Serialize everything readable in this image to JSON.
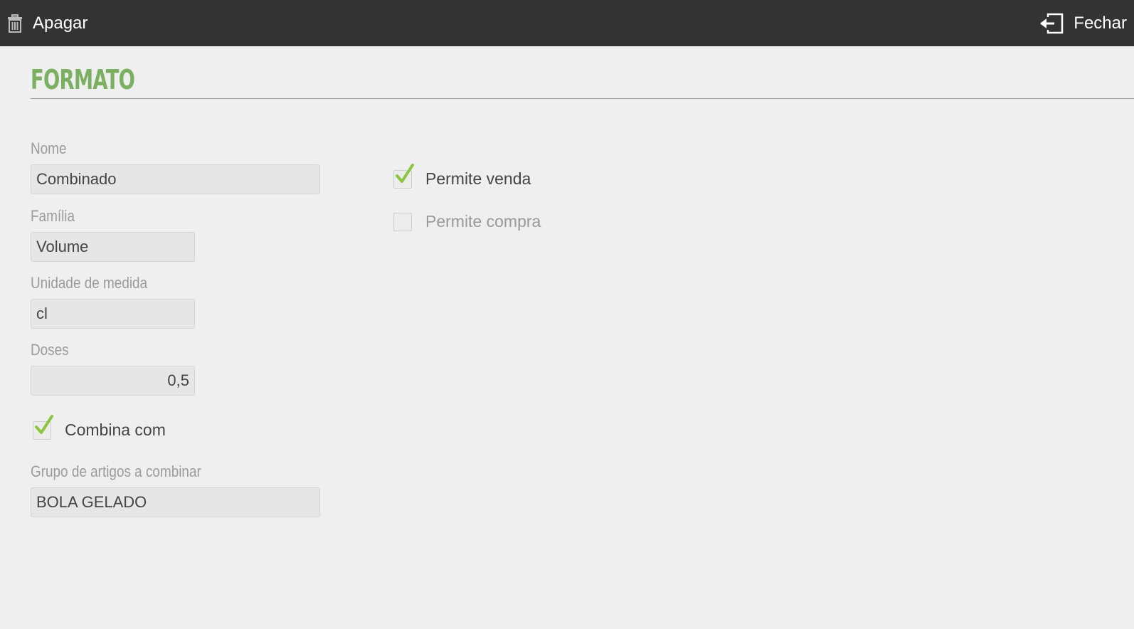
{
  "toolbar": {
    "delete_label": "Apagar",
    "delete_icon": "trash-icon",
    "close_label": "Fechar",
    "close_icon": "exit-icon"
  },
  "page": {
    "title": "FORMATO"
  },
  "form": {
    "nome": {
      "label": "Nome",
      "value": "Combinado"
    },
    "familia": {
      "label": "Família",
      "value": "Volume"
    },
    "unidade": {
      "label": "Unidade de medida",
      "value": "cl"
    },
    "doses": {
      "label": "Doses",
      "value": "0,5"
    },
    "combina": {
      "label": "Combina com",
      "checked": true
    },
    "grupo": {
      "label": "Grupo de artigos a combinar",
      "value": "BOLA GELADO"
    },
    "permite_venda": {
      "label": "Permite venda",
      "checked": true
    },
    "permite_compra": {
      "label": "Permite compra",
      "checked": false
    }
  },
  "colors": {
    "topbar": "#333333",
    "accent": "#7bb062",
    "check": "#8cc63f",
    "background": "#efefef"
  }
}
